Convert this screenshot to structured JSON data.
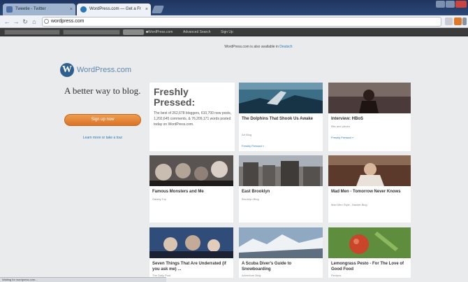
{
  "browser": {
    "tabs": [
      {
        "label": "Tweetie - Twitter",
        "active": false
      },
      {
        "label": "WordPress.com — Get a Fr",
        "active": true
      }
    ],
    "url": "wordpress.com",
    "nav": {
      "back": "←",
      "forward": "→",
      "reload": "↻",
      "home": "⌂"
    }
  },
  "admin_bar": {
    "links": [
      "WordPress.com",
      "Advanced Search",
      "Sign Up"
    ]
  },
  "notice": {
    "text": "WordPress.com is also available in",
    "link": "Deutsch"
  },
  "logo": {
    "text": "WordPress.com",
    "mark": "W"
  },
  "hero": {
    "tagline": "A better way to blog.",
    "signup_label": "Sign up now",
    "learn_more": "Learn more or take a tour"
  },
  "freshly_pressed": {
    "title": "Freshly Pressed:",
    "description": "The best of 262,678 bloggers, 610,700 new posts, 1,202,645 comments, & 76,209,171 words posted today on WordPress.com."
  },
  "posts": [
    {
      "title": "The Dolphins That Shook Us Awake",
      "meta": "Art Blog",
      "link": "Freshly Pressed »"
    },
    {
      "title": "Interview: HBoS",
      "meta": "Bits and pieces",
      "link": "Freshly Pressed »"
    },
    {
      "title": "Famous Monsters and Me",
      "meta": "Gatsby Cry",
      "link": ""
    },
    {
      "title": "East Brooklyn",
      "meta": "Brooklyn Blog",
      "link": ""
    },
    {
      "title": "Mad Men - Tomorrow Never Knows",
      "meta": "Mad Men Style - Basket Blog",
      "link": ""
    },
    {
      "title": "Seven Things That Are Underrated (if you ask me) ...",
      "meta": "The Daily Post",
      "link": ""
    },
    {
      "title": "A Scuba Diver's Guide to Snowboarding",
      "meta": "Adventure Blog",
      "link": ""
    },
    {
      "title": "Lemongrass Pesto - For The Love of Good Food",
      "meta": "Recipes",
      "link": ""
    }
  ],
  "status_bar": {
    "text": "Waiting for wordpress.com..."
  },
  "colors": {
    "accent_orange": "#e0822f",
    "link_blue": "#2a77b5",
    "admin_bar": "#3b3b3b",
    "page_bg": "#e9ebec"
  },
  "icons": [
    "back-icon",
    "forward-icon",
    "reload-icon",
    "home-icon",
    "globe-icon",
    "star-icon",
    "extension-icon",
    "wrench-icon",
    "wordpress-logo-icon"
  ]
}
